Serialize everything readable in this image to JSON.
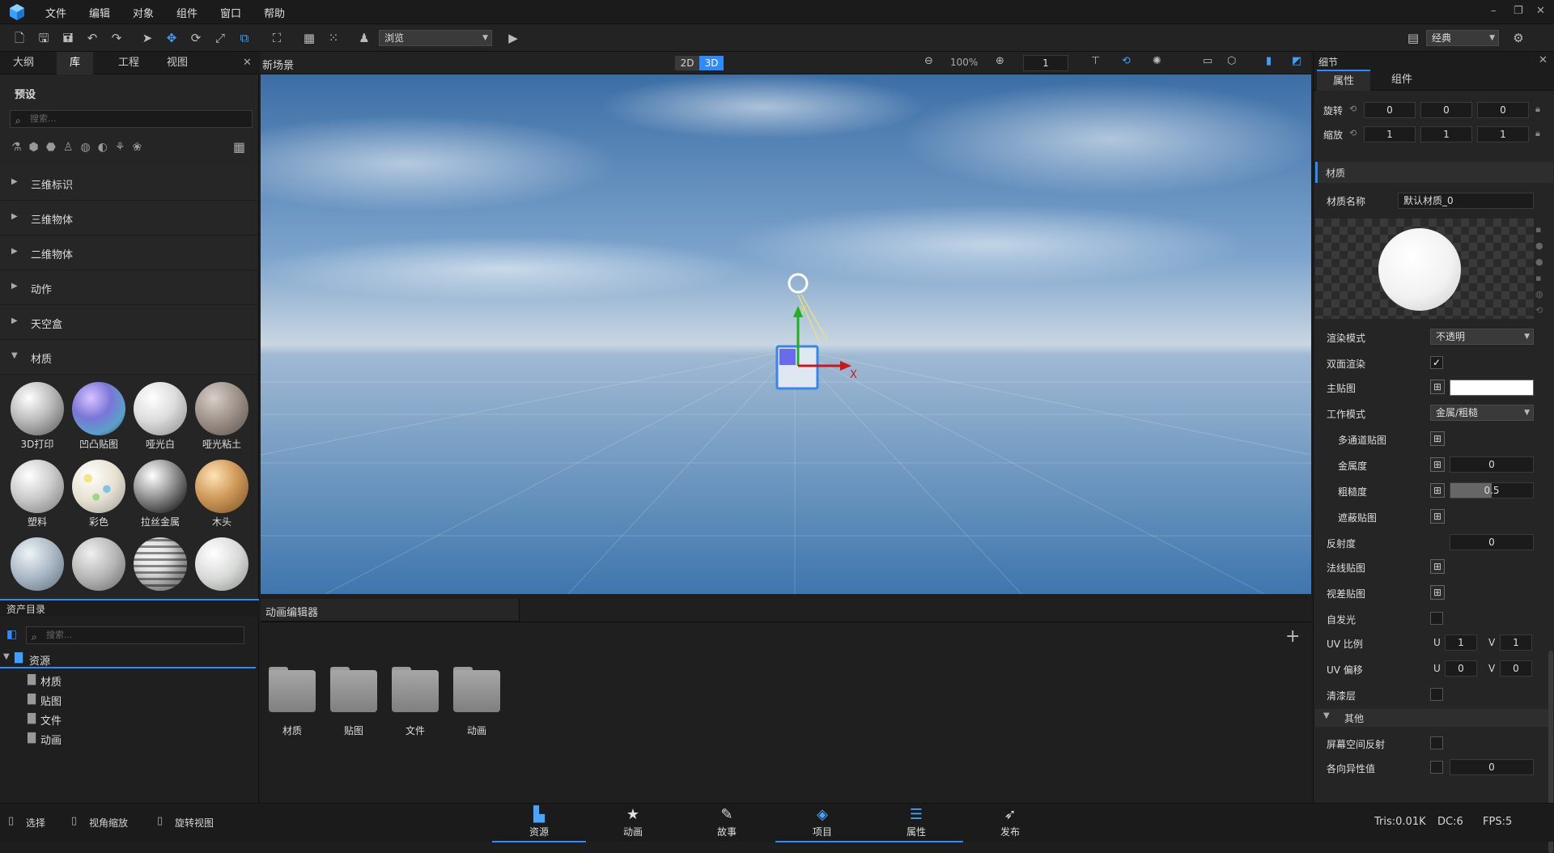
{
  "menu": [
    "文件",
    "编辑",
    "对象",
    "组件",
    "窗口",
    "帮助"
  ],
  "toolbar": {
    "mode_value": "浏览",
    "layout_value": "经典"
  },
  "left_panel": {
    "tabs": [
      "大纲",
      "库",
      "工程",
      "视图"
    ],
    "section_title": "预设",
    "search_placeholder": "搜索...",
    "categories": [
      "三维标识",
      "三维物体",
      "二维物体",
      "动作",
      "天空盒",
      "材质"
    ],
    "materials": [
      "3D打印",
      "凹凸贴图",
      "哑光白",
      "哑光粘土",
      "塑料",
      "彩色",
      "拉丝金属",
      "木头"
    ]
  },
  "viewport": {
    "title": "新场景",
    "view_2d": "2D",
    "view_3d": "3D",
    "zoom": "100%",
    "step": "1",
    "axis_x": "X",
    "axis_y": "Y"
  },
  "details": {
    "title": "细节",
    "tabs": [
      "属性",
      "组件"
    ],
    "rotation_label": "旋转",
    "rotation": [
      "0",
      "0",
      "0"
    ],
    "scale_label": "缩放",
    "scale": [
      "1",
      "1",
      "1"
    ],
    "material_header": "材质",
    "material_name_label": "材质名称",
    "material_name": "默认材质_0",
    "render_mode_label": "渲染模式",
    "render_mode": "不透明",
    "double_sided_label": "双面渲染",
    "main_map_label": "主贴图",
    "work_mode_label": "工作模式",
    "work_mode": "金属/粗糙",
    "multi_channel_label": "多通道贴图",
    "metalness_label": "金属度",
    "metalness": "0",
    "roughness_label": "粗糙度",
    "roughness": "0.5",
    "occlusion_label": "遮蔽贴图",
    "reflectivity_label": "反射度",
    "reflectivity": "0",
    "normal_label": "法线贴图",
    "parallax_label": "视差贴图",
    "emissive_label": "自发光",
    "uv_scale_label": "UV 比例",
    "uv_scale": {
      "u": "1",
      "v": "1"
    },
    "uv_offset_label": "UV 偏移",
    "uv_offset": {
      "u": "0",
      "v": "0"
    },
    "u": "U",
    "v": "V",
    "clearcoat_label": "清漆层",
    "other_header": "其他",
    "ssr_label": "屏幕空间反射",
    "aniso_label": "各向异性值",
    "aniso": "0"
  },
  "assets": {
    "title": "资产目录",
    "search_placeholder": "搜索...",
    "root": "资源",
    "children": [
      "材质",
      "贴图",
      "文件",
      "动画"
    ]
  },
  "anim_editor": {
    "title": "动画编辑器",
    "folders": [
      "材质",
      "贴图",
      "文件",
      "动画"
    ]
  },
  "statusbar": {
    "tools": [
      "选择",
      "视角缩放",
      "旋转视图"
    ],
    "tabs": [
      "资源",
      "动画",
      "故事",
      "项目",
      "属性",
      "发布"
    ],
    "tris": "Tris:0.01K",
    "dc": "DC:6",
    "fps": "FPS:5"
  },
  "colors": {
    "accent": "#2e8bff",
    "panel": "#252525",
    "sky_top": "#3c6ea6",
    "ground": "#4a7fb2"
  }
}
